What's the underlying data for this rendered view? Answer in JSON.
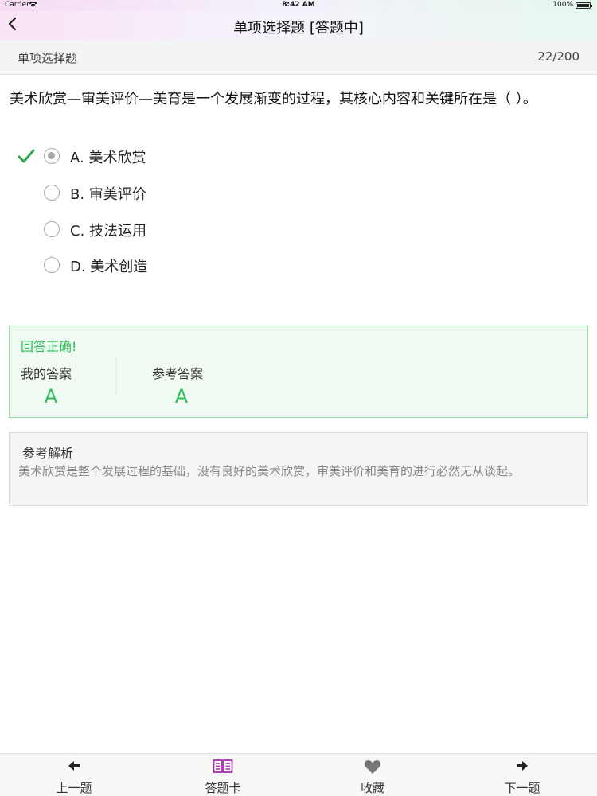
{
  "status_bar": {
    "carrier": "Carrier",
    "time": "8:42 AM",
    "battery": "100%"
  },
  "nav": {
    "back_icon": "chevron-left-icon",
    "title": "单项选择题 [答题中]"
  },
  "subheader": {
    "question_type": "单项选择题",
    "progress": "22/200"
  },
  "question": {
    "text": "美术欣赏—审美评价—美育是一个发展渐变的过程，其核心内容和关键所在是（ ）。",
    "options": [
      {
        "label": "A. 美术欣赏",
        "selected": true,
        "correct_mark": true
      },
      {
        "label": "B. 审美评价",
        "selected": false,
        "correct_mark": false
      },
      {
        "label": "C. 技法运用",
        "selected": false,
        "correct_mark": false
      },
      {
        "label": "D. 美术创造",
        "selected": false,
        "correct_mark": false
      }
    ]
  },
  "result": {
    "status": "回答正确!",
    "my_answer_label": "我的答案",
    "my_answer": "A",
    "reference_label": "参考答案",
    "reference_answer": "A",
    "color": "#2fbf5a"
  },
  "analysis": {
    "heading": "参考解析",
    "body": "美术欣赏是整个发展过程的基础，没有良好的美术欣赏，审美评价和美育的进行必然无从谈起。"
  },
  "tabbar": {
    "items": [
      {
        "label": "上一题",
        "icon": "arrow-left-icon"
      },
      {
        "label": "答题卡",
        "icon": "open-book-icon",
        "icon_color": "#a032a8"
      },
      {
        "label": "收藏",
        "icon": "heart-icon"
      },
      {
        "label": "下一题",
        "icon": "arrow-right-icon"
      }
    ]
  }
}
